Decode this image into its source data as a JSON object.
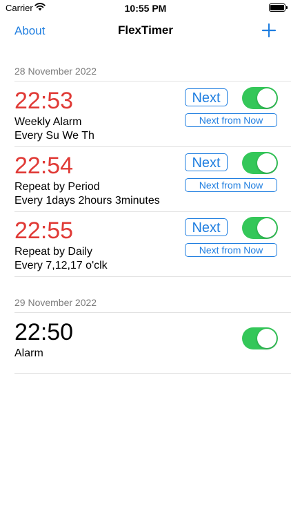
{
  "status_bar": {
    "carrier": "Carrier",
    "time": "10:55 PM"
  },
  "nav": {
    "left_label": "About",
    "title": "FlexTimer",
    "add_icon": "plus-icon"
  },
  "colors": {
    "accent": "#1f7ee0",
    "alarm_red": "#e03a36",
    "toggle_on": "#34c759"
  },
  "sections": [
    {
      "header": "28 November 2022",
      "rows": [
        {
          "time": "22:53",
          "line1": "Weekly Alarm",
          "line2": "Every Su We Th",
          "next_label": "Next",
          "next_from_now_label": "Next from Now",
          "enabled": true
        },
        {
          "time": "22:54",
          "line1": "Repeat by Period",
          "line2": "Every 1days 2hours 3minutes",
          "next_label": "Next",
          "next_from_now_label": "Next from Now",
          "enabled": true
        },
        {
          "time": "22:55",
          "line1": "Repeat by Daily",
          "line2": "Every 7,12,17 o'clk",
          "next_label": "Next",
          "next_from_now_label": "Next from Now",
          "enabled": true
        }
      ]
    },
    {
      "header": "29 November 2022",
      "rows": [
        {
          "time": "22:50",
          "line1": "Alarm",
          "enabled": true
        }
      ]
    }
  ]
}
